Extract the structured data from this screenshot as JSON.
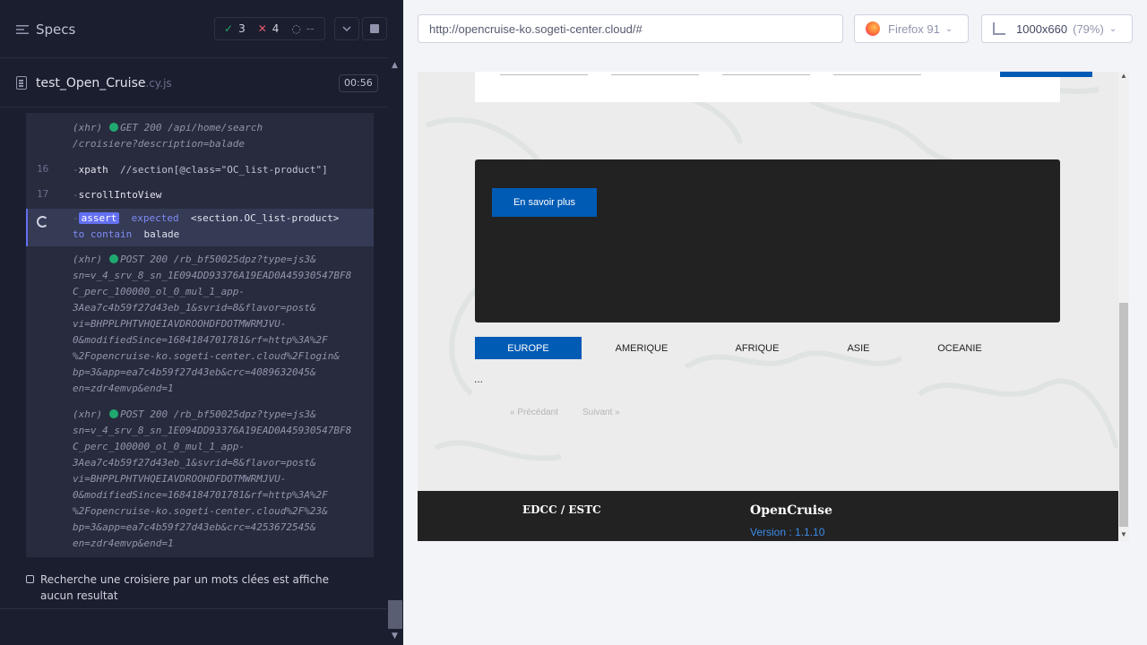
{
  "runner": {
    "specs_title": "Specs",
    "stats": {
      "passed": "3",
      "failed": "4",
      "pending": "--"
    },
    "spec_file": {
      "name": "test_Open_Cruise",
      "ext": ".cy.js",
      "duration": "00:56"
    },
    "commands": [
      {
        "num": "",
        "type": "xhr",
        "label": "(xhr)",
        "method": "GET",
        "status": "200",
        "text": "/api/home/search",
        "line2": "/croisiere?description=balade"
      },
      {
        "num": "16",
        "name": "xpath",
        "message": "//section[@class=\"OC_list-product\"]"
      },
      {
        "num": "17",
        "name": "scrollIntoView",
        "message": ""
      },
      {
        "num": "",
        "name": "assert",
        "active": true,
        "parts": [
          "expected",
          "<section.OC_list-product>",
          "to contain",
          "balade"
        ]
      },
      {
        "num": "",
        "type": "xhr",
        "label": "(xhr)",
        "method": "POST",
        "status": "200",
        "text": "/rb_bf50025dpz?type=js3&",
        "lines": [
          "sn=v_4_srv_8_sn_1E094DD93376A19EAD0A45930547BF8",
          "C_perc_100000_ol_0_mul_1_app-",
          "3Aea7c4b59f27d43eb_1&svrid=8&flavor=post&",
          "vi=BHPPLPHTVHQEIAVDROOHDFDOTMWRMJVU-",
          "0&modifiedSince=1684184701781&rf=http%3A%2F",
          "%2Fopencruise-ko.sogeti-center.cloud%2Flogin&",
          "bp=3&app=ea7c4b59f27d43eb&crc=4089632045&",
          "en=zdr4emvp&end=1"
        ]
      },
      {
        "num": "",
        "type": "xhr",
        "label": "(xhr)",
        "method": "POST",
        "status": "200",
        "text": "/rb_bf50025dpz?type=js3&",
        "lines": [
          "sn=v_4_srv_8_sn_1E094DD93376A19EAD0A45930547BF8",
          "C_perc_100000_ol_0_mul_1_app-",
          "3Aea7c4b59f27d43eb_1&svrid=8&flavor=post&",
          "vi=BHPPLPHTVHQEIAVDROOHDFDOTMWRMJVU-",
          "0&modifiedSince=1684184701781&rf=http%3A%2F",
          "%2Fopencruise-ko.sogeti-center.cloud%2F%23&",
          "bp=3&app=ea7c4b59f27d43eb&crc=4253672545&",
          "en=zdr4emvp&end=1"
        ]
      }
    ],
    "next_test": "Recherche une croisiere par un mots clées est affiche aucun resultat"
  },
  "aut": {
    "url": "http://opencruise-ko.sogeti-center.cloud/#",
    "browser": "Firefox 91",
    "viewport": "1000x660",
    "scale": "(79%)",
    "page": {
      "learn_more": "En savoir plus",
      "regions": [
        "EUROPE",
        "AMERIQUE",
        "AFRIQUE",
        "ASIE",
        "OCEANIE"
      ],
      "active_region": "EUROPE",
      "ellipsis": "...",
      "prev": "«   Précédant",
      "next": "Suivant   »",
      "footer_left": "EDCC / ESTC",
      "footer_brand": "OpenCruise",
      "footer_version": "Version : 1.1.10"
    }
  },
  "colors": {
    "runner_bg": "#1b1e2e",
    "pass": "#1fa971",
    "fail": "#e45770",
    "accent": "#6470f3",
    "site_blue": "#005bb5"
  },
  "icons": [
    "menu-icon",
    "check-icon",
    "cross-icon",
    "spinner-icon",
    "chevron-down-icon",
    "stop-icon",
    "file-icon",
    "firefox-icon",
    "ruler-icon"
  ]
}
